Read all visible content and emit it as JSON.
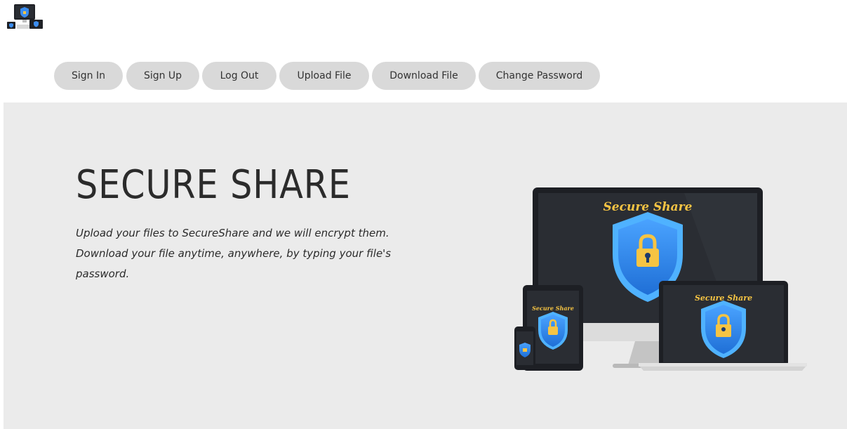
{
  "brand": {
    "logo_icon": "devices-shield-logo-icon",
    "device_brand_text": "Secure Share"
  },
  "nav": {
    "items": [
      {
        "label": "Sign In"
      },
      {
        "label": "Sign Up"
      },
      {
        "label": "Log Out"
      },
      {
        "label": "Upload File"
      },
      {
        "label": "Download File"
      },
      {
        "label": "Change Password"
      }
    ]
  },
  "hero": {
    "title": "SECURE SHARE",
    "description": "Upload your files to SecureShare and we will encrypt them. Download your file anytime, anywhere, by typing your file's password.",
    "illustration_icon": "devices-shield-illustration"
  },
  "colors": {
    "button_bg": "#d9d9d9",
    "hero_bg": "#ebebeb",
    "shield_blue": "#3b8df0",
    "lock_yellow": "#f6c443",
    "screen_dark": "#25272d"
  }
}
